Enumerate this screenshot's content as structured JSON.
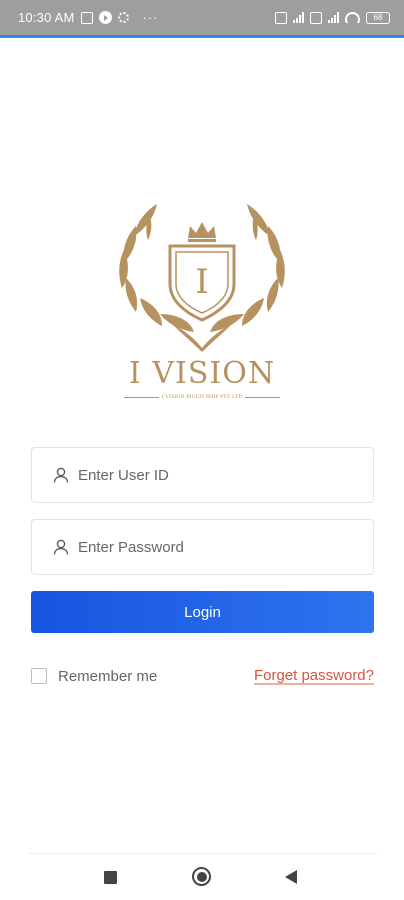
{
  "status_bar": {
    "time": "10:30 AM",
    "more": "···",
    "battery": "68"
  },
  "brand": {
    "name": "I VISION",
    "emblem_letter": "I",
    "tagline": "I VISION MULTI SHIP PVT LTD",
    "color": "#b79261"
  },
  "login_form": {
    "user_id_placeholder": "Enter User ID",
    "password_placeholder": "Enter Password",
    "login_label": "Login",
    "remember_label": "Remember me",
    "remember_checked": false,
    "forget_label": "Forget password?",
    "accent_color": "#1656e0",
    "link_color": "#d8533d"
  },
  "nav_bar": {
    "recents_icon": "square-icon",
    "home_icon": "circle-icon",
    "back_icon": "triangle-back-icon"
  }
}
